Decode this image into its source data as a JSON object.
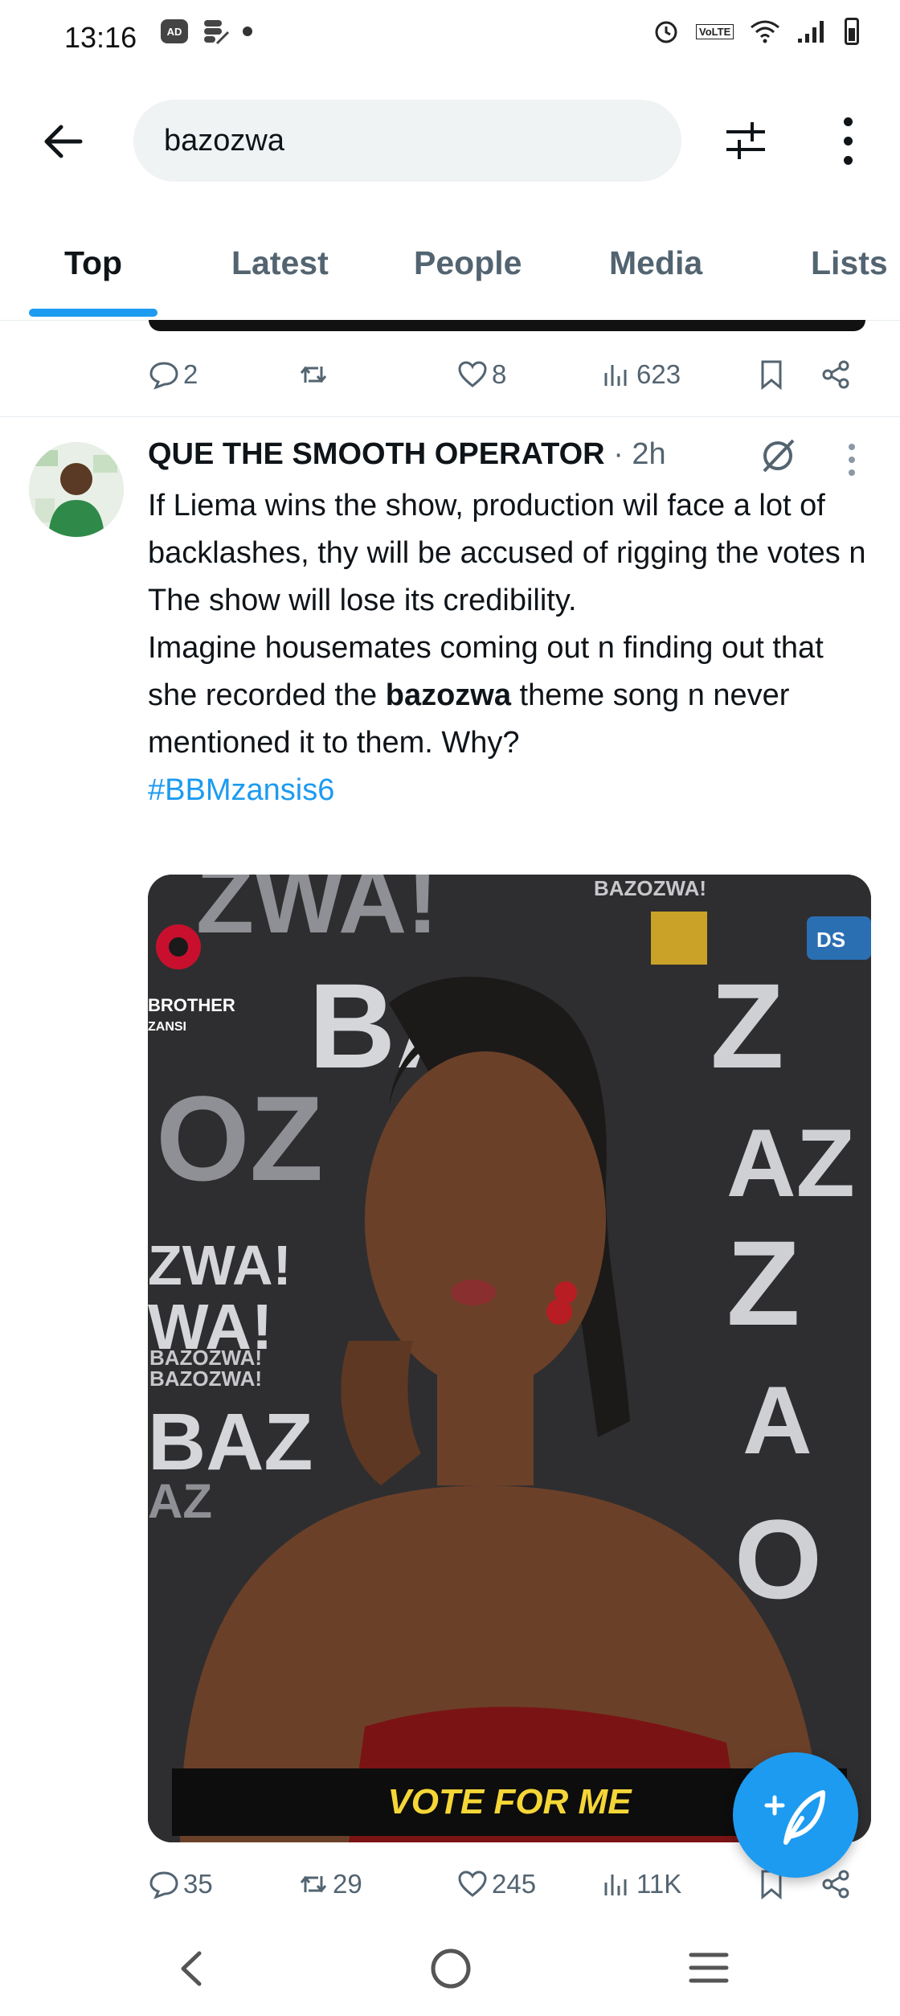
{
  "status": {
    "time": "13:16",
    "ad_badge": "AD",
    "volte": "VoLTE"
  },
  "search": {
    "query": "bazozwa"
  },
  "tabs": [
    {
      "label": "Top"
    },
    {
      "label": "Latest"
    },
    {
      "label": "People"
    },
    {
      "label": "Media"
    },
    {
      "label": "Lists"
    }
  ],
  "prev_tweet": {
    "replies": "2",
    "reposts": "",
    "likes": "8",
    "views": "623"
  },
  "tweet": {
    "author": "QUE THE SMOOTH OPERATOR",
    "time": "· 2h",
    "line1": "If Liema wins the show, production wil face a lot of backlashes,  thy will be accused of rigging the votes n The show will lose its credibility.",
    "line2_before": "Imagine housemates coming out n finding out that she recorded the ",
    "line2_highlight": "bazozwa",
    "line2_after": " theme song n never mentioned it to them. Why?",
    "hashtag": "#BBMzansis6",
    "media": {
      "banner": "VOTE FOR ME",
      "bg_words": [
        "ZWA!",
        "BAZOZWA!",
        "BA",
        "OZ",
        "ZWA!",
        "WA!",
        "BAZOZWA!",
        "BAZOZWA!",
        "BAZ",
        "AZ"
      ],
      "brother_label": "BROTHER",
      "zansi_label": "ZANSI",
      "ds_label": "DS"
    },
    "stats": {
      "replies": "35",
      "reposts": "29",
      "likes": "245",
      "views": "11K"
    }
  }
}
